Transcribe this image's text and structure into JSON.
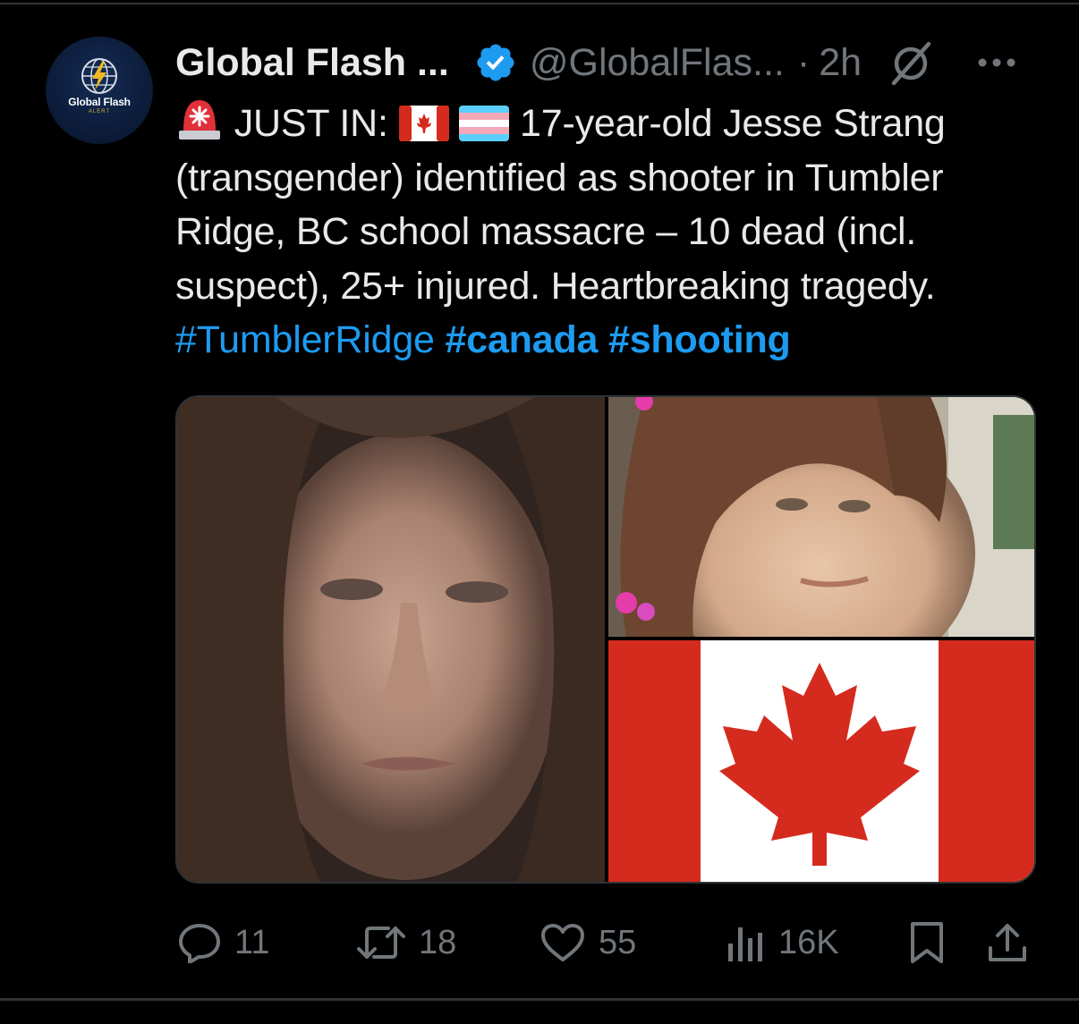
{
  "author": {
    "avatar_name": "Global Flash",
    "avatar_sub": "ALERT",
    "display_name": "Global Flash ...",
    "handle": "@GlobalFlas...",
    "separator": "·",
    "time": "2h"
  },
  "tweet": {
    "line1_text": "JUST IN: ",
    "line1_rest": " 17-year-old Jesse Strang",
    "line2": "(transgender) identified as shooter in Tumbler",
    "line3": "Ridge, BC school massacre – 10 dead (incl.",
    "line4": "suspect), 25+ injured.  Heartbreaking tragedy.",
    "hashtags": [
      "#TumblerRidge",
      "#canada",
      "#shooting"
    ]
  },
  "actions": {
    "replies": "11",
    "reposts": "18",
    "likes": "55",
    "views": "16K"
  },
  "icons": {
    "siren": "rotating-light-emoji",
    "flag1": "canada-flag-emoji",
    "flag2": "transgender-flag-emoji",
    "verified": "verified-badge-icon",
    "grok": "grok-icon",
    "more": "more-icon"
  },
  "colors": {
    "background": "#000000",
    "text": "#e7e9ea",
    "muted": "#71767b",
    "link": "#1d9bf0",
    "divider": "#2f3336",
    "flag_red": "#d52b1e"
  }
}
